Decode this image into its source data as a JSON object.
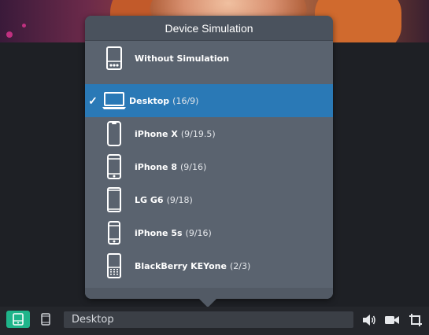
{
  "popup": {
    "title": "Device Simulation",
    "items": [
      {
        "label": "Without Simulation",
        "ratio": "",
        "icon": "no-simulation-icon",
        "selected": false
      },
      {
        "label": "Desktop",
        "ratio": "(16/9)",
        "icon": "laptop-icon",
        "selected": true
      },
      {
        "label": "iPhone X",
        "ratio": "(9/19.5)",
        "icon": "iphone-x-icon",
        "selected": false
      },
      {
        "label": "iPhone 8",
        "ratio": "(9/16)",
        "icon": "iphone-icon",
        "selected": false
      },
      {
        "label": "LG G6",
        "ratio": "(9/18)",
        "icon": "android-phone-icon",
        "selected": false
      },
      {
        "label": "iPhone 5s",
        "ratio": "(9/16)",
        "icon": "iphone-icon",
        "selected": false
      },
      {
        "label": "BlackBerry KEYone",
        "ratio": "(2/3)",
        "icon": "blackberry-icon",
        "selected": false
      }
    ],
    "check_mark": "✓"
  },
  "toolbar": {
    "device_value": "Desktop",
    "accent_color": "#1fb48a",
    "selected_color": "#2a79b6"
  }
}
